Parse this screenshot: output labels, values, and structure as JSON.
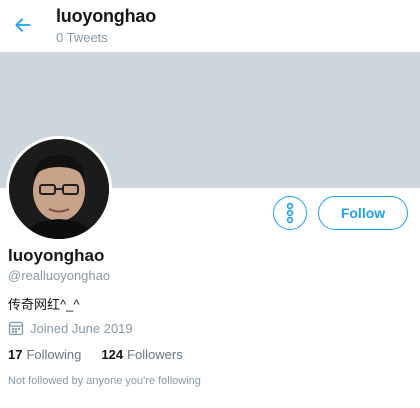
{
  "header": {
    "title": "luoyonghao",
    "tweet_count": "0 Tweets"
  },
  "actions": {
    "follow_label": "Follow"
  },
  "profile": {
    "display_name": "luoyonghao",
    "handle": "@realluoyonghao",
    "bio": "传奇网红^_^",
    "joined": "Joined June 2019",
    "following_count": "17",
    "following_label": "Following",
    "followers_count": "124",
    "followers_label": "Followers",
    "follow_notice": "Not followed by anyone you're following"
  },
  "colors": {
    "accent": "#1da1f2",
    "banner": "#ccd6dd",
    "muted": "#8899a6"
  },
  "icons": {
    "back": "arrow-left-icon",
    "more": "more-vertical-icon",
    "calendar": "calendar-icon"
  }
}
